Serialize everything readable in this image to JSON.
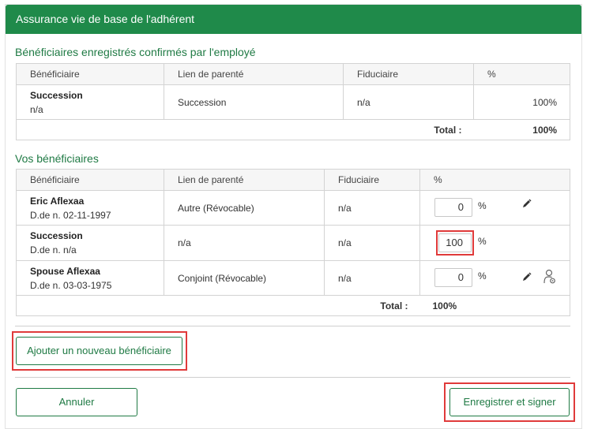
{
  "panel": {
    "title": "Assurance vie de base de l'adhérent"
  },
  "confirmed": {
    "title": "Bénéficiaires enregistrés confirmés par l'employé",
    "columns": [
      "Bénéficiaire",
      "Lien de parenté",
      "Fiduciaire",
      "%"
    ],
    "rows": [
      {
        "name": "Succession",
        "sub": "n/a",
        "relation": "Succession",
        "trustee": "n/a",
        "percent": "100%"
      }
    ],
    "total_label": "Total :",
    "total_value": "100%"
  },
  "mine": {
    "title": "Vos bénéficiaires",
    "columns": [
      "Bénéficiaire",
      "Lien de parenté",
      "Fiduciaire",
      "%"
    ],
    "rows": [
      {
        "name": "Eric Aflexaa",
        "sub": "D.de n. 02-11-1997",
        "relation": "Autre (Révocable)",
        "trustee": "n/a",
        "percent": "0",
        "sign": "%"
      },
      {
        "name": "Succession",
        "sub": "D.de n. n/a",
        "relation": "n/a",
        "trustee": "n/a",
        "percent": "100",
        "sign": "%"
      },
      {
        "name": "Spouse Aflexaa",
        "sub": "D.de n. 03-03-1975",
        "relation": "Conjoint (Révocable)",
        "trustee": "n/a",
        "percent": "0",
        "sign": "%"
      }
    ],
    "total_label": "Total :",
    "total_value": "100%"
  },
  "buttons": {
    "add": "Ajouter un nouveau bénéficiaire",
    "cancel": "Annuler",
    "save": "Enregistrer et signer"
  },
  "icons": {
    "edit": "pencil-icon",
    "trustee": "person-gear-icon"
  },
  "colors": {
    "brand": "#1f8a4a",
    "highlight": "#e03a3a"
  }
}
